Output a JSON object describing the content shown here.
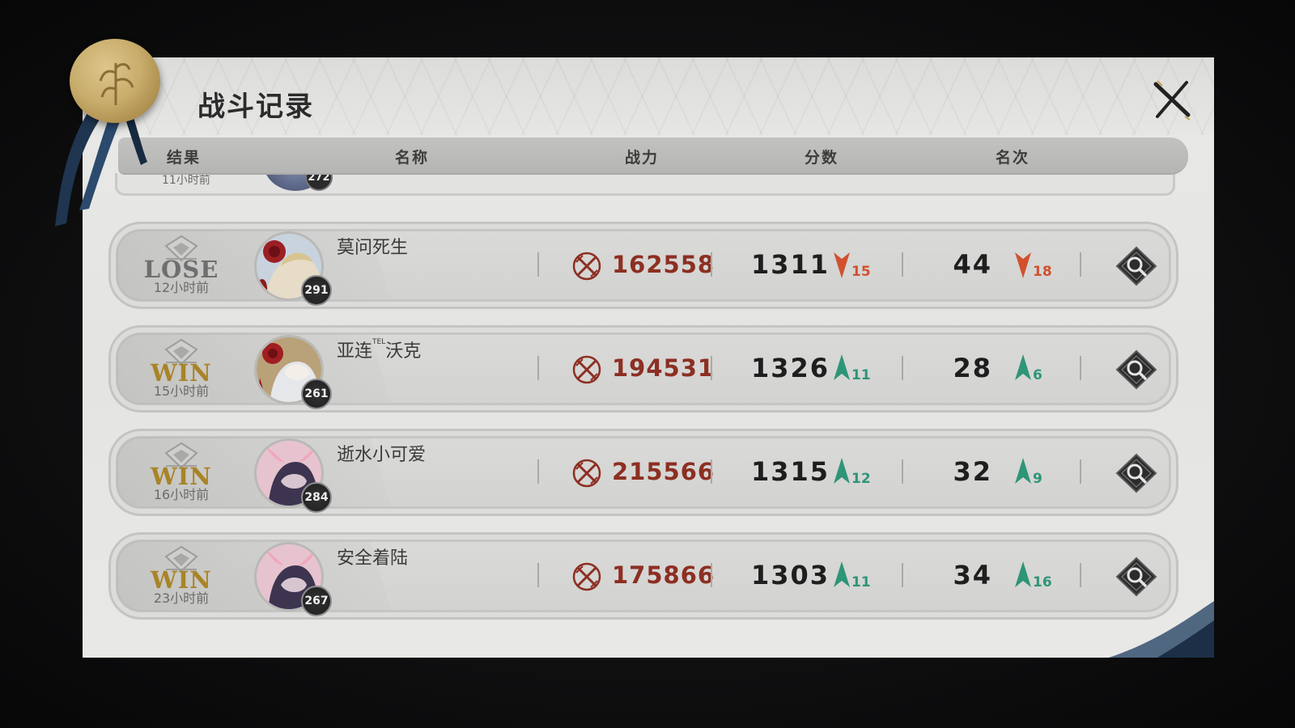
{
  "title": "战斗记录",
  "columns": {
    "result": "结果",
    "name": "名称",
    "power": "战力",
    "score": "分数",
    "rank": "名次"
  },
  "partial_row": {
    "time": "11小时前",
    "level": "272"
  },
  "rows": [
    {
      "result": "LOSE",
      "outcome": "lose",
      "time": "12小时前",
      "level": "291",
      "name": "莫问死生",
      "name_sup": "",
      "name_rest": "",
      "power": "162558",
      "score": "1311",
      "score_delta": "15",
      "score_dir": "down",
      "rank": "44",
      "rank_delta": "18",
      "rank_dir": "down",
      "portrait": "rose-girl"
    },
    {
      "result": "WIN",
      "outcome": "win",
      "time": "15小时前",
      "level": "261",
      "name": "亚连",
      "name_sup": "TEL",
      "name_rest": "沃克",
      "power": "194531",
      "score": "1326",
      "score_delta": "11",
      "score_dir": "up",
      "rank": "28",
      "rank_delta": "6",
      "rank_dir": "up",
      "portrait": "rose-pale-girl"
    },
    {
      "result": "WIN",
      "outcome": "win",
      "time": "16小时前",
      "level": "284",
      "name": "逝水小可爱",
      "name_sup": "",
      "name_rest": "",
      "power": "215566",
      "score": "1315",
      "score_delta": "12",
      "score_dir": "up",
      "rank": "32",
      "rank_delta": "9",
      "rank_dir": "up",
      "portrait": "horned-girl"
    },
    {
      "result": "WIN",
      "outcome": "win",
      "time": "23小时前",
      "level": "267",
      "name": "安全着陆",
      "name_sup": "",
      "name_rest": "",
      "power": "175866",
      "score": "1303",
      "score_delta": "11",
      "score_dir": "up",
      "rank": "34",
      "rank_delta": "16",
      "rank_dir": "up",
      "portrait": "horned-girl"
    }
  ],
  "colors": {
    "win": "#a88428",
    "lose": "#6f6f6f",
    "power": "#8c2f22",
    "up": "#2e9577",
    "down": "#d1512f"
  },
  "icons": {
    "seal": "wax-seal-icon",
    "close": "close-icon",
    "power": "crossed-swords-icon",
    "view": "magnifier-icon",
    "result": "shield-emblem-icon"
  }
}
